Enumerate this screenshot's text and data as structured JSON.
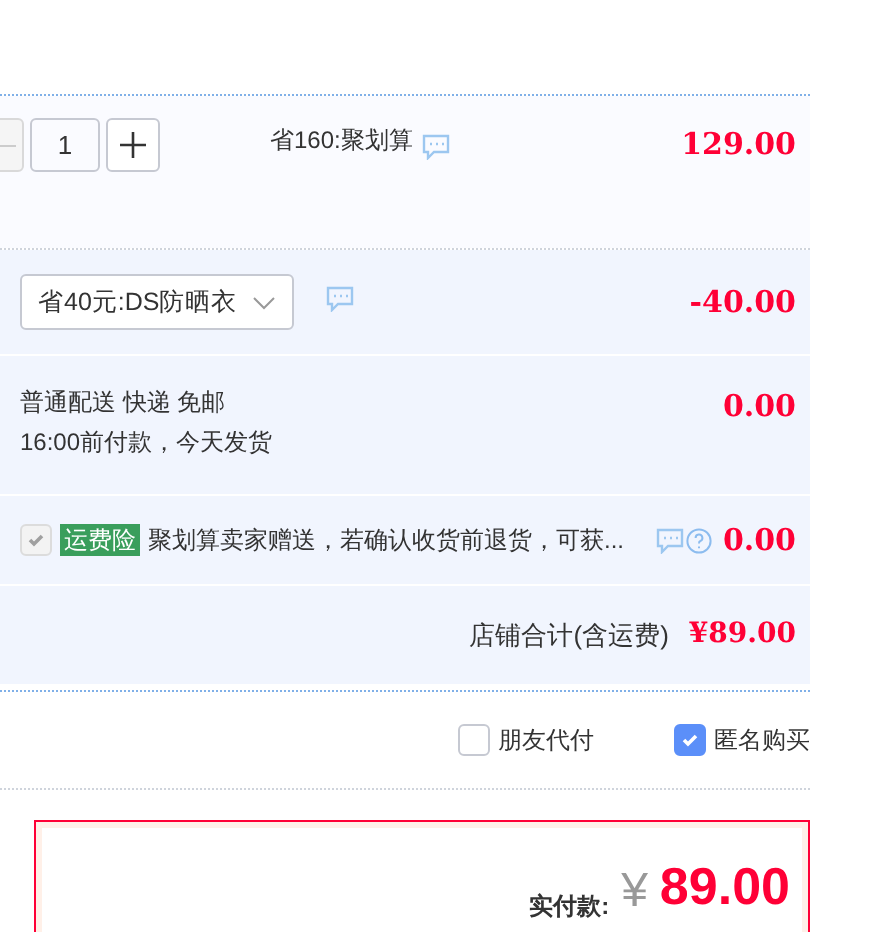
{
  "item": {
    "quantity": "1",
    "promo": "省160:聚划算",
    "price": "129.00"
  },
  "coupon": {
    "value": "省40元:DS防晒衣",
    "amount": "-40.00"
  },
  "shipping": {
    "lines": [
      "普通配送 快递 免邮",
      "16:00前付款，今天发货"
    ],
    "amount": "0.00"
  },
  "insurance": {
    "checked": true,
    "disabled": true,
    "tag": "运费险",
    "text": "聚划算卖家赠送，若确认收货前退货，可获...",
    "amount": "0.00"
  },
  "shop_total": {
    "label": "店铺合计(含运费)",
    "amount": "¥89.00"
  },
  "options": [
    {
      "label": "朋友代付",
      "checked": false
    },
    {
      "label": "匿名购买",
      "checked": true
    }
  ],
  "payment": {
    "label": "实付款:",
    "currency": "¥",
    "amount": "89.00"
  }
}
